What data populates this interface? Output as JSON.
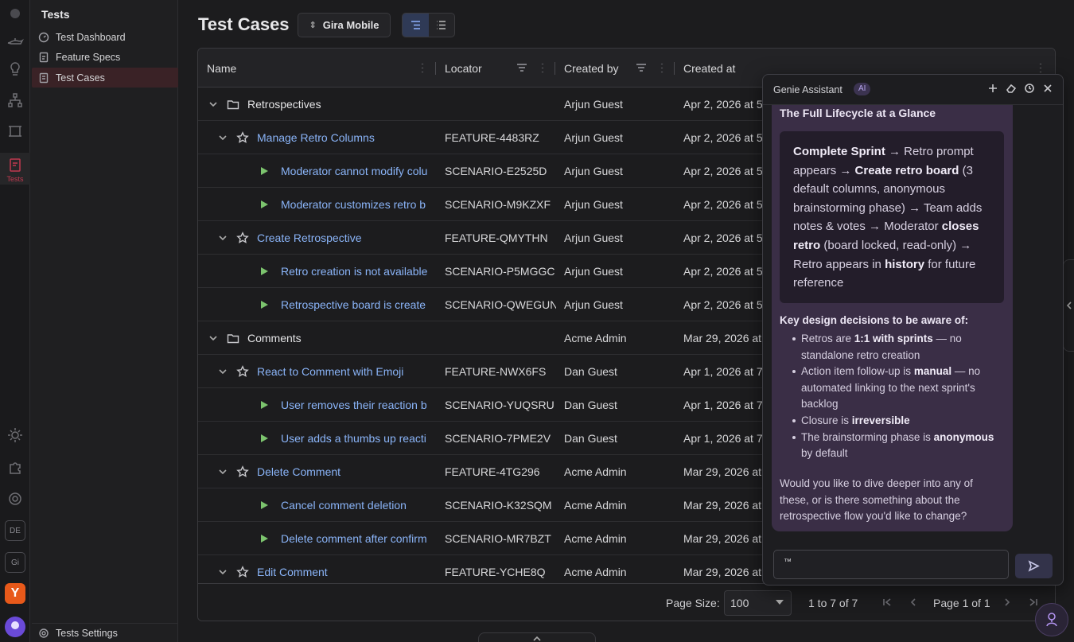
{
  "rail": {
    "active_label": "Tests",
    "badges": [
      "DE",
      "Gi"
    ],
    "y_badge": "Y"
  },
  "sidebar": {
    "title": "Tests",
    "items": [
      {
        "label": "Test Dashboard",
        "icon": "dashboard-icon"
      },
      {
        "label": "Feature Specs",
        "icon": "document-icon"
      },
      {
        "label": "Test Cases",
        "icon": "checklist-icon"
      }
    ],
    "settings_label": "Tests Settings"
  },
  "header": {
    "title": "Test Cases",
    "project": "Gira Mobile"
  },
  "table": {
    "columns": [
      "Name",
      "Locator",
      "Created by",
      "Created at"
    ],
    "rows": [
      {
        "level": 0,
        "kind": "folder",
        "name": "Retrospectives",
        "locator": "",
        "by": "Arjun Guest",
        "at": "Apr 2, 2026 at 5"
      },
      {
        "level": 1,
        "kind": "feature",
        "name": "Manage Retro Columns",
        "locator": "FEATURE-4483RZ",
        "by": "Arjun Guest",
        "at": "Apr 2, 2026 at 5"
      },
      {
        "level": 2,
        "kind": "scenario",
        "name": "Moderator cannot modify colu",
        "locator": "SCENARIO-E2525D",
        "by": "Arjun Guest",
        "at": "Apr 2, 2026 at 5"
      },
      {
        "level": 2,
        "kind": "scenario",
        "name": "Moderator customizes retro b",
        "locator": "SCENARIO-M9KZXF",
        "by": "Arjun Guest",
        "at": "Apr 2, 2026 at 5"
      },
      {
        "level": 1,
        "kind": "feature",
        "name": "Create Retrospective",
        "locator": "FEATURE-QMYTHN",
        "by": "Arjun Guest",
        "at": "Apr 2, 2026 at 5"
      },
      {
        "level": 2,
        "kind": "scenario",
        "name": "Retro creation is not available",
        "locator": "SCENARIO-P5MGGC",
        "by": "Arjun Guest",
        "at": "Apr 2, 2026 at 5"
      },
      {
        "level": 2,
        "kind": "scenario",
        "name": "Retrospective board is create",
        "locator": "SCENARIO-QWEGUN",
        "by": "Arjun Guest",
        "at": "Apr 2, 2026 at 5"
      },
      {
        "level": 0,
        "kind": "folder",
        "name": "Comments",
        "locator": "",
        "by": "Acme Admin",
        "at": "Mar 29, 2026 at"
      },
      {
        "level": 1,
        "kind": "feature",
        "name": "React to Comment with Emoji",
        "locator": "FEATURE-NWX6FS",
        "by": "Dan Guest",
        "at": "Apr 1, 2026 at 7"
      },
      {
        "level": 2,
        "kind": "scenario",
        "name": "User removes their reaction b",
        "locator": "SCENARIO-YUQSRU",
        "by": "Dan Guest",
        "at": "Apr 1, 2026 at 7"
      },
      {
        "level": 2,
        "kind": "scenario",
        "name": "User adds a thumbs up reacti",
        "locator": "SCENARIO-7PME2V",
        "by": "Dan Guest",
        "at": "Apr 1, 2026 at 7"
      },
      {
        "level": 1,
        "kind": "feature",
        "name": "Delete Comment",
        "locator": "FEATURE-4TG296",
        "by": "Acme Admin",
        "at": "Mar 29, 2026 at"
      },
      {
        "level": 2,
        "kind": "scenario",
        "name": "Cancel comment deletion",
        "locator": "SCENARIO-K32SQM",
        "by": "Acme Admin",
        "at": "Mar 29, 2026 at"
      },
      {
        "level": 2,
        "kind": "scenario",
        "name": "Delete comment after confirm",
        "locator": "SCENARIO-MR7BZT",
        "by": "Acme Admin",
        "at": "Mar 29, 2026 at"
      },
      {
        "level": 1,
        "kind": "feature",
        "name": "Edit Comment",
        "locator": "FEATURE-YCHE8Q",
        "by": "Acme Admin",
        "at": "Mar 29, 2026 at"
      }
    ]
  },
  "footer": {
    "page_size_label": "Page Size:",
    "page_size": "100",
    "range": "1 to 7 of 7",
    "page_label": "Page 1 of 1"
  },
  "genie": {
    "title": "Genie Assistant",
    "badge": "AI",
    "lifecycle_title": "The Full Lifecycle at a Glance",
    "lifecycle_html_parts": [
      {
        "b": true,
        "t": "Complete Sprint"
      },
      {
        "b": false,
        "t": " → Retro prompt appears → "
      },
      {
        "b": true,
        "t": "Create retro board"
      },
      {
        "b": false,
        "t": " (3 default columns, anonymous brainstorming phase) → Team adds notes & votes → Moderator "
      },
      {
        "b": true,
        "t": "closes retro"
      },
      {
        "b": false,
        "t": " (board locked, read-only) → Retro appears in "
      },
      {
        "b": true,
        "t": "history"
      },
      {
        "b": false,
        "t": " for future reference"
      }
    ],
    "key_title": "Key design decisions to be aware of:",
    "key_items": [
      [
        {
          "b": false,
          "t": "Retros are "
        },
        {
          "b": true,
          "t": "1:1 with sprints"
        },
        {
          "b": false,
          "t": " — no standalone retro creation"
        }
      ],
      [
        {
          "b": false,
          "t": "Action item follow-up is "
        },
        {
          "b": true,
          "t": "manual"
        },
        {
          "b": false,
          "t": " — no automated linking to the next sprint's backlog"
        }
      ],
      [
        {
          "b": false,
          "t": "Closure is "
        },
        {
          "b": true,
          "t": "irreversible"
        }
      ],
      [
        {
          "b": false,
          "t": "The brainstorming phase is "
        },
        {
          "b": true,
          "t": "anonymous"
        },
        {
          "b": false,
          "t": " by default"
        }
      ]
    ],
    "follow_up": "Would you like to dive deeper into any of these, or is there something about the retrospective flow you'd like to change?",
    "input_value": "™"
  }
}
